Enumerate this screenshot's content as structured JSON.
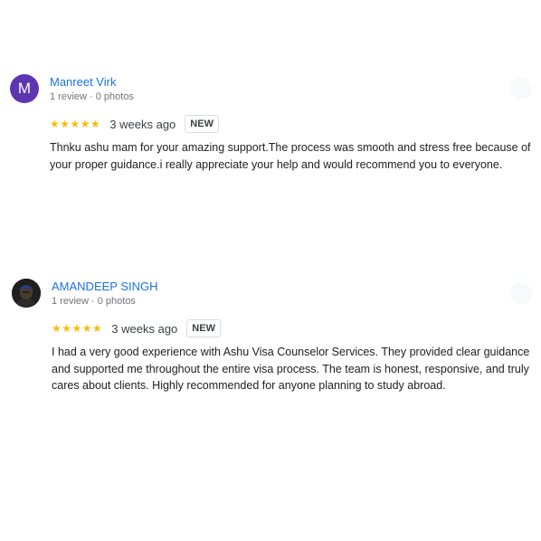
{
  "reviews": [
    {
      "avatar_letter": "M",
      "author": "Manreet Virk",
      "meta": "1 review · 0 photos",
      "stars": "★★★★★",
      "rating": 5,
      "date": "3 weeks ago",
      "badge": "NEW",
      "text": "Thnku ashu mam for your amazing support.The process was smooth and stress free because of your proper guidance.i really appreciate your help and would recommend you to everyone.",
      "colors": {
        "avatar_bg": "#5e35b1"
      }
    },
    {
      "avatar_icon": "profile-photo",
      "author": "AMANDEEP SINGH",
      "meta": "1 review · 0 photos",
      "stars": "★★★★★",
      "rating": 5,
      "date": "3 weeks ago",
      "badge": "NEW",
      "text": "I had a very good experience with Ashu Visa Counselor Services. They provided clear guidance and supported me throughout the entire visa process. The team is honest, responsive, and truly cares about clients. Highly recommended for anyone planning to study abroad."
    }
  ],
  "colors": {
    "author_link": "#1a73e8",
    "star": "#fbbc04",
    "meta_text": "#70757a"
  }
}
